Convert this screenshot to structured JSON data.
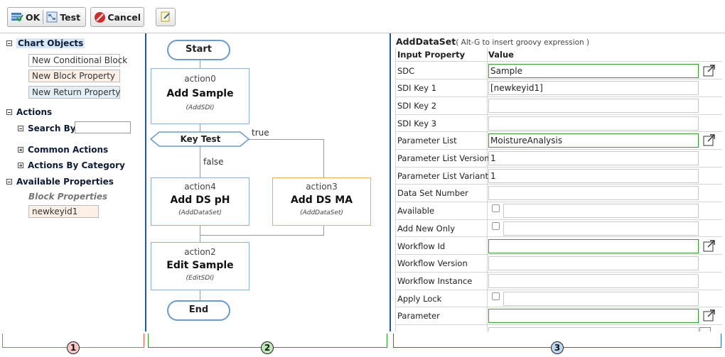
{
  "toolbar": {
    "ok_label": "OK",
    "test_label": "Test",
    "cancel_label": "Cancel"
  },
  "left": {
    "chart_objects": "Chart Objects",
    "chips": [
      "New Conditional Block",
      "New Block Property",
      "New Return Property"
    ],
    "actions": "Actions",
    "search_by": "Search By:",
    "common_actions": "Common Actions",
    "actions_by_category": "Actions By Category",
    "available_properties": "Available Properties",
    "block_properties": "Block Properties",
    "block_property_item": "newkeyid1"
  },
  "flow": {
    "start": "Start",
    "end": "End",
    "decision": "Key Test",
    "true_label": "true",
    "false_label": "false",
    "action0": {
      "name": "action0",
      "title": "Add Sample",
      "type": "(AddSDI)"
    },
    "action4": {
      "name": "action4",
      "title": "Add DS pH",
      "type": "(AddDataSet)"
    },
    "action3": {
      "name": "action3",
      "title": "Add DS MA",
      "type": "(AddDataSet)"
    },
    "action2": {
      "name": "action2",
      "title": "Edit Sample",
      "type": "(EditSDI)"
    }
  },
  "props": {
    "title": "AddDataSet",
    "hint": "( Alt-G to insert groovy expression )",
    "col_property": "Input Property",
    "col_value": "Value",
    "rows": [
      {
        "name": "SDC",
        "value": "Sample"
      },
      {
        "name": "SDI Key 1",
        "value": "[newkeyid1]"
      },
      {
        "name": "SDI Key 2",
        "value": ""
      },
      {
        "name": "SDI Key 3",
        "value": ""
      },
      {
        "name": "Parameter List",
        "value": "MoistureAnalysis"
      },
      {
        "name": "Parameter List Version",
        "value": "1"
      },
      {
        "name": "Parameter List Variant",
        "value": "1"
      },
      {
        "name": "Data Set Number",
        "value": ""
      },
      {
        "name": "Available",
        "value": ""
      },
      {
        "name": "Add New Only",
        "value": ""
      },
      {
        "name": "Workflow Id",
        "value": ""
      },
      {
        "name": "Workflow Version",
        "value": ""
      },
      {
        "name": "Workflow Instance",
        "value": ""
      },
      {
        "name": "Apply Lock",
        "value": ""
      },
      {
        "name": "Parameter",
        "value": ""
      }
    ]
  },
  "annotations": [
    "1",
    "2",
    "3"
  ],
  "colors": {
    "section1": "#e06060",
    "section2": "#2e9a2e",
    "section3": "#2f6fa8",
    "accent": "#1f5b9c"
  }
}
